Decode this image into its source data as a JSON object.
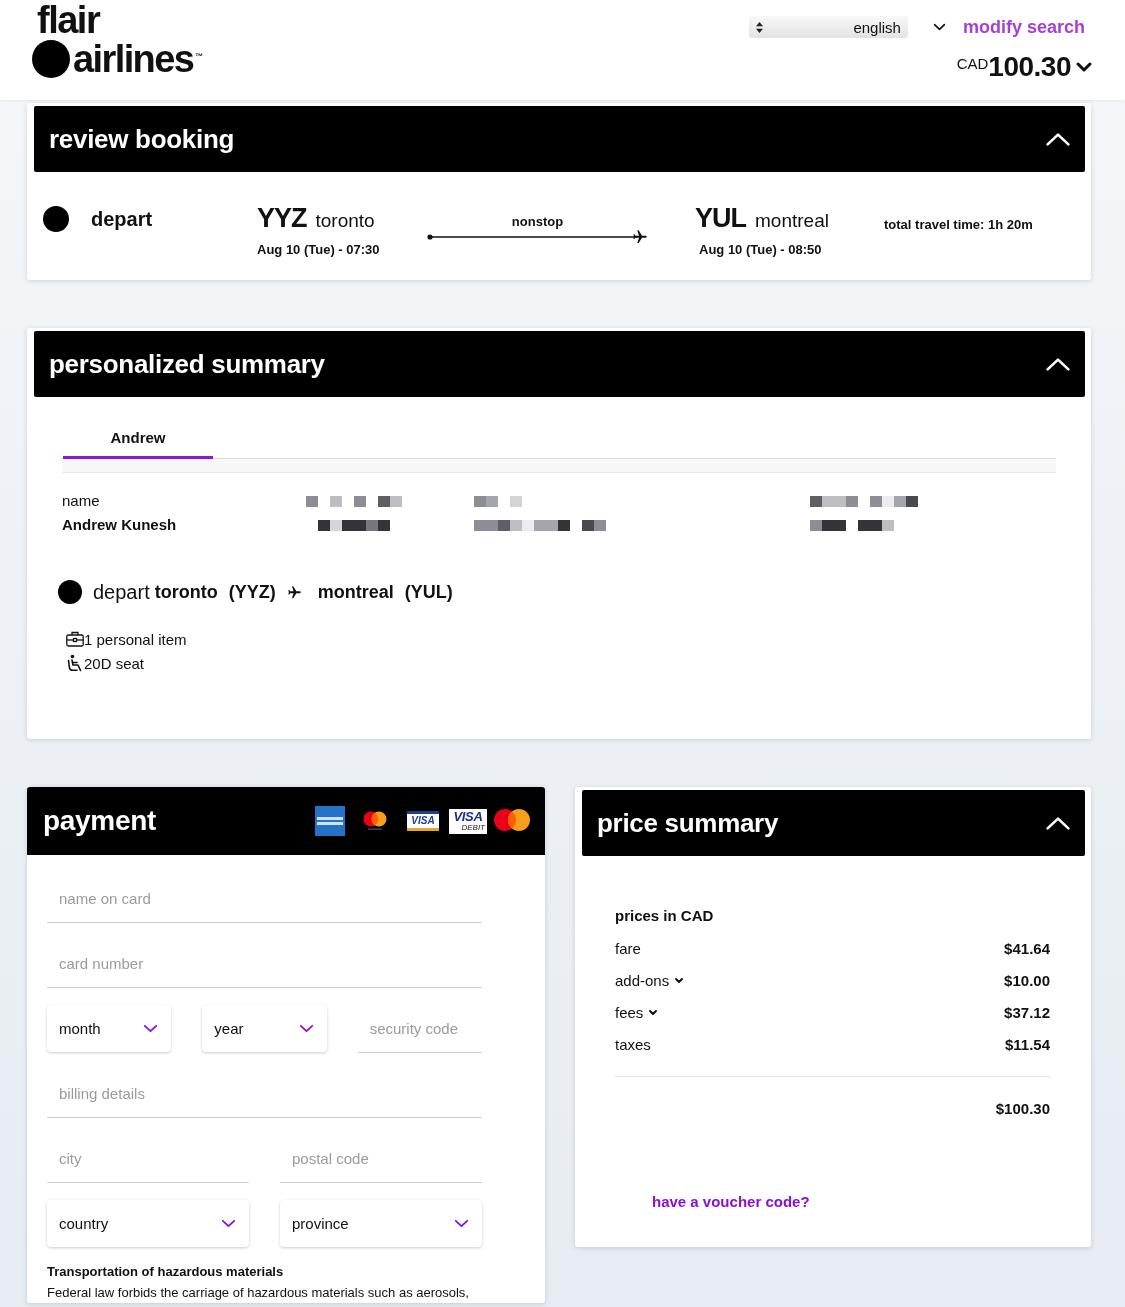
{
  "header": {
    "logo": {
      "line_1": "flair",
      "line_2": "airlines",
      "trademark": "™"
    },
    "language_select": {
      "value": "english"
    },
    "modify_search": "modify search",
    "total": {
      "currency": "CAD",
      "amount": "100.30"
    }
  },
  "review_booking": {
    "title": "review booking",
    "expanded": true,
    "flight": {
      "direction": "depart",
      "origin": {
        "code": "YYZ",
        "city": "toronto",
        "time": "Aug 10 (Tue) - 07:30"
      },
      "stops": "nonstop",
      "destination": {
        "code": "YUL",
        "city": "montreal",
        "time": "Aug 10 (Tue) - 08:50"
      },
      "travel_time": "total travel time: 1h 20m"
    }
  },
  "personalized_summary": {
    "title": "personalized summary",
    "expanded": true,
    "tabs": [
      {
        "label": "Andrew",
        "selected": true
      }
    ],
    "passenger_fields": [
      {
        "label": "name",
        "value": "Andrew Kunesh",
        "redacted": false
      },
      {
        "redacted": true
      },
      {
        "redacted": true
      },
      {
        "redacted": true
      }
    ],
    "segment": {
      "direction": "depart",
      "origin": "toronto",
      "origin_code": "(YYZ)",
      "destination": "montreal",
      "destination_code": "(YUL)"
    },
    "extras": [
      {
        "kind": "bag",
        "text": "1 personal item"
      },
      {
        "kind": "seat",
        "text": "20D seat"
      }
    ]
  },
  "payment": {
    "title": "payment",
    "card_logos": [
      {
        "kind": "amex"
      },
      {
        "kind": "mastercard"
      },
      {
        "kind": "visa",
        "text": "VISA"
      },
      {
        "kind": "visadebit",
        "text": "VISA",
        "subtext": "DEBIT"
      },
      {
        "kind": "mastercarddebit"
      }
    ],
    "field_rows": [
      {
        "fields": [
          {
            "kind": "text",
            "placeholder": "name on card"
          }
        ]
      },
      {
        "fields": [
          {
            "kind": "text",
            "placeholder": "card number"
          }
        ]
      },
      {
        "fields": [
          {
            "kind": "select",
            "value": "month"
          },
          {
            "kind": "select",
            "value": "year"
          },
          {
            "kind": "text",
            "placeholder": "security code"
          }
        ]
      },
      {
        "fields": [
          {
            "kind": "text",
            "placeholder": "billing details"
          }
        ]
      },
      {
        "fields": [
          {
            "kind": "text",
            "placeholder": "city"
          },
          {
            "kind": "text",
            "placeholder": "postal code"
          }
        ]
      },
      {
        "fields": [
          {
            "kind": "select",
            "value": "country"
          },
          {
            "kind": "select",
            "value": "province"
          }
        ]
      }
    ],
    "notice": {
      "title": "Transportation of hazardous materials",
      "text": "Federal law forbids the carriage of hazardous materials such as aerosols,"
    }
  },
  "price_summary": {
    "title": "price summary",
    "expanded": true,
    "currency_note": "prices in CAD",
    "lines": [
      {
        "label": "fare",
        "amount": "$41.64",
        "expandable": false
      },
      {
        "label": "add-ons",
        "amount": "$10.00",
        "expandable": true
      },
      {
        "label": "fees",
        "amount": "$37.12",
        "expandable": true
      },
      {
        "label": "taxes",
        "amount": "$11.54",
        "expandable": false
      }
    ],
    "total": "$100.30",
    "voucher_link": "have a voucher code?"
  }
}
